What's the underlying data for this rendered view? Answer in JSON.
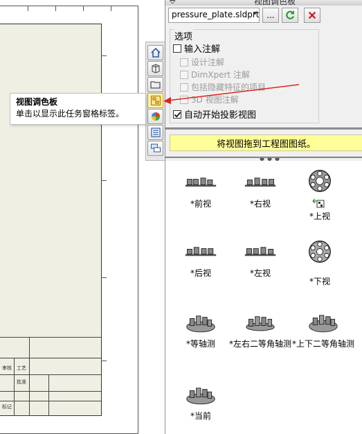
{
  "panel": {
    "title": "视图调色板",
    "file_select": {
      "value": "pressure_plate.sldprt"
    },
    "browse_label": "...",
    "options": {
      "legend": "选项",
      "import_annotations": "输入注解",
      "design_annotations": "设计注解",
      "dimxpert_annotations": "DimXpert 注解",
      "hidden_features": "包括隐藏特征的项目",
      "view_3d_annotations": "3D 视图注解",
      "auto_projected": "自动开始投影视图"
    },
    "drag_hint": "将视图拖到工程图图纸。"
  },
  "tooltip": {
    "title": "视图调色板",
    "body": "单击以显示此任务窗格标签。"
  },
  "views": [
    {
      "label": "*前视",
      "icon": "front-view-icon"
    },
    {
      "label": "*右视",
      "icon": "right-view-icon"
    },
    {
      "label": "*上视",
      "icon": "top-view-icon"
    },
    {
      "label": "*后视",
      "icon": "back-view-icon"
    },
    {
      "label": "*左视",
      "icon": "left-view-icon"
    },
    {
      "label": "*下视",
      "icon": "bottom-view-icon"
    },
    {
      "label": "*等轴测",
      "icon": "isometric-view-icon"
    },
    {
      "label": "*左右二等角轴测",
      "icon": "dimetric-lr-view-icon"
    },
    {
      "label": "*上下二等角轴测",
      "icon": "dimetric-tb-view-icon"
    },
    {
      "label": "*当前",
      "icon": "current-view-icon"
    }
  ],
  "titleblock": {
    "cells": [
      "审核",
      "工艺",
      "批准",
      "标记"
    ]
  },
  "colors": {
    "banner": "#ffff99",
    "refresh": "#2e9a2e",
    "cancel": "#d01818",
    "arrow": "#e02020",
    "active_tab": "#fff3b0"
  }
}
